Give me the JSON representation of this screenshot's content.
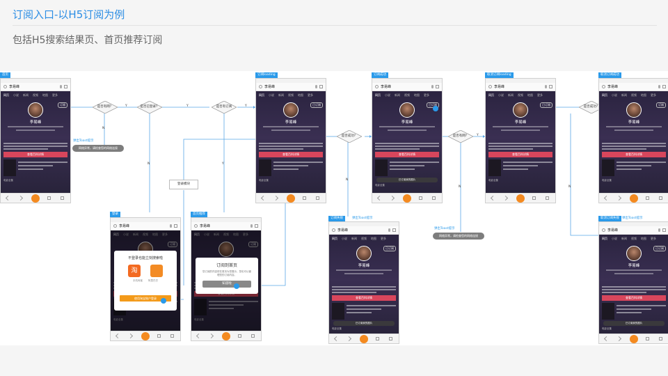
{
  "header": {
    "title": "订阅入口-以H5订阅为例",
    "subtitle": "包括H5搜索结果页、首页推荐订阅"
  },
  "phone": {
    "query": "李易峰",
    "tabs": [
      "网页",
      "小说",
      "新闻",
      "视频",
      "地图",
      "更多"
    ],
    "subscribe": "订阅",
    "subscribed": "已订阅",
    "name": "李易峰",
    "detail_button": "查看百科详情",
    "footer": "电影全集",
    "toast_subscribed": "已订阅我的图片"
  },
  "tags": {
    "p1": "首页",
    "p2": "订阅loading",
    "p3": "订阅成功",
    "p4": "取消订阅loading",
    "p5": "取消订阅成功",
    "p6": "登录",
    "p7": "首页推荐",
    "p8": "订阅失败",
    "p8b": "弹出Toast提示",
    "p9": "取消订阅失败",
    "p9b": "弹出Toast提示"
  },
  "decisions": {
    "d1": "是否有网？",
    "d2": "是否已登录？",
    "d3": "是否有订阅",
    "d4": "是否成功？",
    "d5": "是否有网？",
    "d6": "是否成功？"
  },
  "edges": {
    "yes": "Y",
    "no": "N"
  },
  "notes": {
    "toast_a_label": "弹出Toast提示",
    "toast_a": "网络异常，请检查您的网络连接",
    "toast_b_label": "弹出Toast提示",
    "toast_b": "网络异常，请检查您的网络连接",
    "login_module": "登录模块"
  },
  "login_dialog": {
    "title": "不登录也能立刻搜索啦",
    "app1": "淘",
    "app2": "手机淘宝",
    "app3": "阿里巴巴",
    "button": "使用淘宝账户登录"
  },
  "sub_dialog": {
    "title": "订阅到首页",
    "body": "您订阅的内容将在首页为您展示，您也可以管理您的订阅内容。",
    "button": "知道啦"
  }
}
